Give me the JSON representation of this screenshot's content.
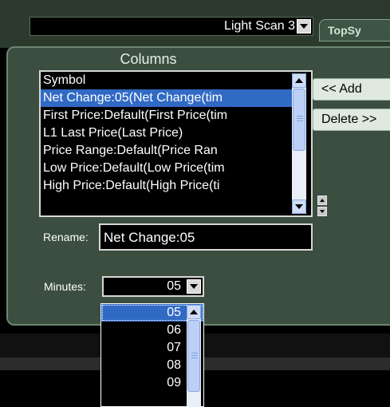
{
  "scan_selector": {
    "value": "Light Scan 3"
  },
  "tab": {
    "label": "TopSy"
  },
  "columns": {
    "title": "Columns",
    "items": [
      "Symbol",
      "Net Change:05(Net Change(tim",
      "First Price:Default(First Price(tim",
      "L1 Last Price(Last Price)",
      "Price Range:Default(Price Ran",
      "Low Price:Default(Low Price(tim",
      "High Price:Default(High Price(ti"
    ],
    "selected_index": 1
  },
  "buttons": {
    "add": "<< Add",
    "delete": "Delete >>"
  },
  "rename": {
    "label": "Rename:",
    "value": "Net Change:05"
  },
  "minutes": {
    "label": "Minutes:",
    "value": "05",
    "options": [
      "05",
      "06",
      "07",
      "08",
      "09"
    ]
  }
}
